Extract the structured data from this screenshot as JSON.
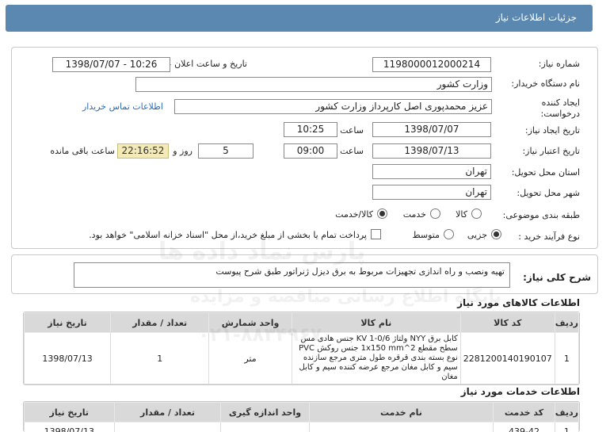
{
  "header": {
    "title": "جزئیات اطلاعات نیاز"
  },
  "form": {
    "need_number_label": "شماره نیاز:",
    "need_number": "1198000012000214",
    "announce_label": "تاریخ و ساعت اعلان عمومی:",
    "announce_value": "1398/07/07 - 10:26",
    "buyer_org_label": "نام دستگاه خریدار:",
    "buyer_org": "وزارت کشور",
    "creator_label_1": "ایجاد کننده",
    "creator_label_2": "درخواست:",
    "creator": "عزیز محمدپوری اصل کارپرداز وزارت کشور",
    "contact_link": "اطلاعات تماس خریدار",
    "created_date_label": "تاریخ ایجاد نیاز:",
    "created_date": "1398/07/07",
    "time_label_1": "ساعت",
    "created_time": "10:25",
    "validity_label": "تاریخ اعتبار نیاز:",
    "validity_date": "1398/07/13",
    "time_label_2": "ساعت",
    "validity_time": "09:00",
    "days_value": "5",
    "days_label": "روز و",
    "remaining_time": "22:16:52",
    "remaining_label": "ساعت باقی مانده",
    "province_label": "استان محل تحویل:",
    "province": "تهران",
    "city_label": "شهر محل تحویل:",
    "city": "تهران",
    "category_label": "طبقه بندی موضوعی:",
    "category_options": [
      "کالا",
      "خدمت",
      "کالا/خدمت"
    ],
    "category_selected": "کالا/خدمت",
    "process_label": "نوع فرآیند خرید :",
    "process_options": [
      "جزیی",
      "متوسط"
    ],
    "process_selected": "جزیی",
    "payment_note": "پرداخت تمام یا بخشی از مبلغ خرید،از محل \"اسناد خزانه اسلامی\" خواهد بود."
  },
  "description": {
    "label": "شرح کلی نیاز:",
    "text": "تهیه ونصب و راه اندازی تجهیزات مربوط به برق دیزل ژنراتور طبق شرح پیوست"
  },
  "goods": {
    "section_title": "اطلاعات کالاهای مورد نیاز",
    "headers": [
      "ردیف",
      "کد کالا",
      "نام کالا",
      "واحد شمارش",
      "تعداد / مقدار",
      "تاریخ نیاز"
    ],
    "rows": [
      {
        "row": "1",
        "code": "2281200140190107",
        "name": "کابل برق NYY ولتاژ KV 1-0/6 جنس هادی مس سطح مقطع 1x150 mm^2 جنس روکش PVC نوع بسته بندی قرقره طول متری مرجع سازنده سیم و کابل مغان مرجع عرضه کننده سیم و کابل مغان",
        "unit": "متر",
        "qty": "1",
        "date": "1398/07/13"
      }
    ]
  },
  "services": {
    "section_title": "اطلاعات خدمات مورد نیاز",
    "headers": [
      "ردیف",
      "کد خدمت",
      "نام خدمت",
      "واحد اندازه گیری",
      "تعداد / مقدار",
      "تاریخ نیاز"
    ],
    "partial_row": {
      "row": "1",
      "code": "439-42",
      "date": "1398/07/13"
    }
  },
  "watermark": {
    "line1": "پارس نماد داده ها",
    "line2": "پایگاه اطلاع رسانی مناقصه و مزایده",
    "line3": "۰۲۱-۸۸۳۴۹۶۷۰"
  }
}
